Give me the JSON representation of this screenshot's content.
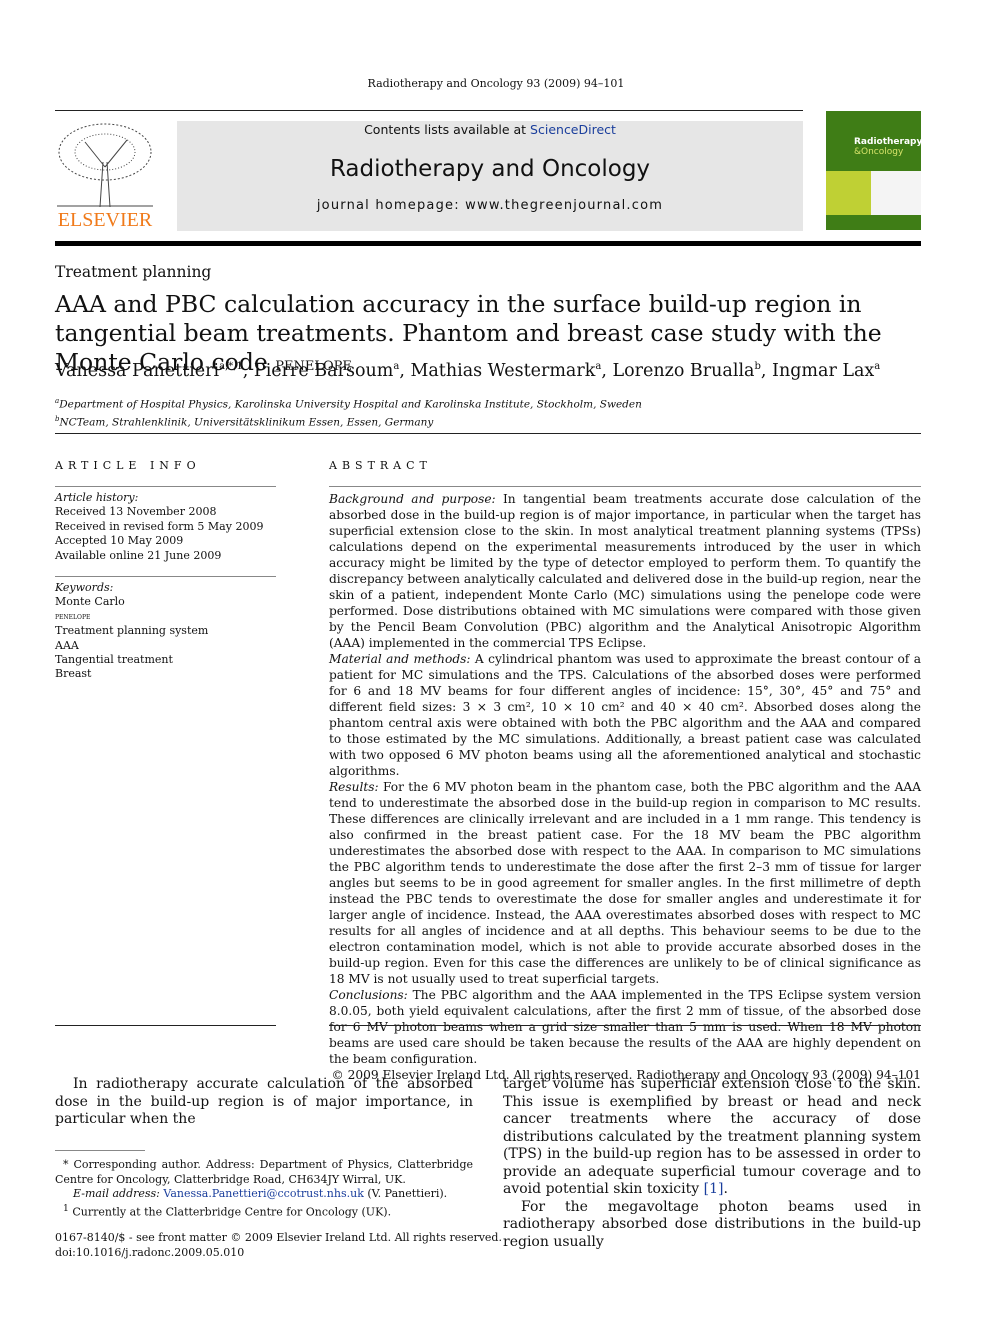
{
  "running_head": "Radiotherapy and Oncology 93 (2009) 94–101",
  "header": {
    "publisher": "ELSEVIER",
    "contents_prefix": "Contents lists available at",
    "contents_link": "ScienceDirect",
    "journal": "Radiotherapy and Oncology",
    "homepage": "journal homepage: www.thegreenjournal.com",
    "cover_title_1": "Radiotherapy",
    "cover_title_2": "&Oncology"
  },
  "section": "Treatment planning",
  "title": "AAA and PBC calculation accuracy in the surface build-up region in tangential beam treatments. Phantom and breast case study with the Monte Carlo code",
  "title_code": "penelope",
  "authors": [
    {
      "name": "Vanessa Panettieri",
      "sup": "a,*,1"
    },
    {
      "name": "Pierre Barsoum",
      "sup": "a"
    },
    {
      "name": "Mathias Westermark",
      "sup": "a"
    },
    {
      "name": "Lorenzo Brualla",
      "sup": "b"
    },
    {
      "name": "Ingmar Lax",
      "sup": "a"
    }
  ],
  "affiliations": [
    {
      "sup": "a",
      "text": "Department of Hospital Physics, Karolinska University Hospital and Karolinska Institute, Stockholm, Sweden"
    },
    {
      "sup": "b",
      "text": "NCTeam, Strahlenklinik, Universitätsklinikum Essen, Essen, Germany"
    }
  ],
  "article_info": {
    "heading": "ARTICLE INFO",
    "history_label": "Article history:",
    "history": [
      "Received 13 November 2008",
      "Received in revised form 5 May 2009",
      "Accepted 10 May 2009",
      "Available online 21 June 2009"
    ],
    "keywords_label": "Keywords:",
    "keywords": [
      "Monte Carlo",
      "penelope",
      "Treatment planning system",
      "AAA",
      "Tangential treatment",
      "Breast"
    ]
  },
  "abstract": {
    "heading": "ABSTRACT",
    "bg_label": "Background and purpose:",
    "bg": "In tangential beam treatments accurate dose calculation of the absorbed dose in the build-up region is of major importance, in particular when the target has superficial extension close to the skin. In most analytical treatment planning systems (TPSs) calculations depend on the experimental measurements introduced by the user in which accuracy might be limited by the type of detector employed to perform them. To quantify the discrepancy between analytically calculated and delivered dose in the build-up region, near the skin of a patient, independent Monte Carlo (MC) simulations using the penelope code were performed. Dose distributions obtained with MC simulations were compared with those given by the Pencil Beam Convolution (PBC) algorithm and the Analytical Anisotropic Algorithm (AAA) implemented in the commercial TPS Eclipse.",
    "mm_label": "Material and methods:",
    "mm": "A cylindrical phantom was used to approximate the breast contour of a patient for MC simulations and the TPS. Calculations of the absorbed doses were performed for 6 and 18 MV beams for four different angles of incidence: 15°, 30°, 45° and 75° and different field sizes: 3 × 3 cm², 10 × 10 cm² and 40 × 40 cm². Absorbed doses along the phantom central axis were obtained with both the PBC algorithm and the AAA and compared to those estimated by the MC simulations. Additionally, a breast patient case was calculated with two opposed 6 MV photon beams using all the aforementioned analytical and stochastic algorithms.",
    "res_label": "Results:",
    "res": "For the 6 MV photon beam in the phantom case, both the PBC algorithm and the AAA tend to underestimate the absorbed dose in the build-up region in comparison to MC results. These differences are clinically irrelevant and are included in a 1 mm range. This tendency is also confirmed in the breast patient case. For the 18 MV beam the PBC algorithm underestimates the absorbed dose with respect to the AAA. In comparison to MC simulations the PBC algorithm tends to underestimate the dose after the first 2–3 mm of tissue for larger angles but seems to be in good agreement for smaller angles. In the first millimetre of depth instead the PBC tends to overestimate the dose for smaller angles and underestimate it for larger angle of incidence. Instead, the AAA overestimates absorbed doses with respect to MC results for all angles of incidence and at all depths. This behaviour seems to be due to the electron contamination model, which is not able to provide accurate absorbed doses in the build-up region. Even for this case the differences are unlikely to be of clinical significance as 18 MV is not usually used to treat superficial targets.",
    "con_label": "Conclusions:",
    "con": "The PBC algorithm and the AAA implemented in the TPS Eclipse system version 8.0.05, both yield equivalent calculations, after the first 2 mm of tissue, of the absorbed dose for 6 MV photon beams when a grid size smaller than 5 mm is used. When 18 MV photon beams are used care should be taken because the results of the AAA are highly dependent on the beam configuration.",
    "copyright": "© 2009 Elsevier Ireland Ltd. All rights reserved. Radiotherapy and Oncology 93 (2009) 94–101"
  },
  "body": {
    "col1_p1": "In radiotherapy accurate calculation of the absorbed dose in the build-up region is of major importance, in particular when the",
    "col2_p1": "target volume has superficial extension close to the skin. This issue is exemplified by breast or head and neck cancer treatments where the accuracy of dose distributions calculated by the treatment planning system (TPS) in the build-up region has to be assessed in order to provide an adequate superficial tumour coverage and to avoid potential skin toxicity",
    "col2_ref": "[1]",
    "col2_p2": "For the megavoltage photon beams used in radiotherapy absorbed dose distributions in the build-up region usually"
  },
  "footnotes": {
    "corr_mark": "*",
    "corr": "Corresponding author. Address: Department of Physics, Clatterbridge Centre for Oncology, Clatterbridge Road, CH634JY Wirral, UK.",
    "email_label": "E-mail address:",
    "email": "Vanessa.Panettieri@ccotrust.nhs.uk",
    "email_suffix": "(V. Panettieri).",
    "fn1_mark": "1",
    "fn1": "Currently at the Clatterbridge Centre for Oncology (UK)."
  },
  "footer": {
    "issn": "0167-8140/$ - see front matter © 2009 Elsevier Ireland Ltd. All rights reserved.",
    "doi": "doi:10.1016/j.radonc.2009.05.010"
  },
  "colors": {
    "elsevier_orange": "#f07a1a",
    "link_blue": "#1a3e9c",
    "cover_green": "#3f7d16"
  }
}
